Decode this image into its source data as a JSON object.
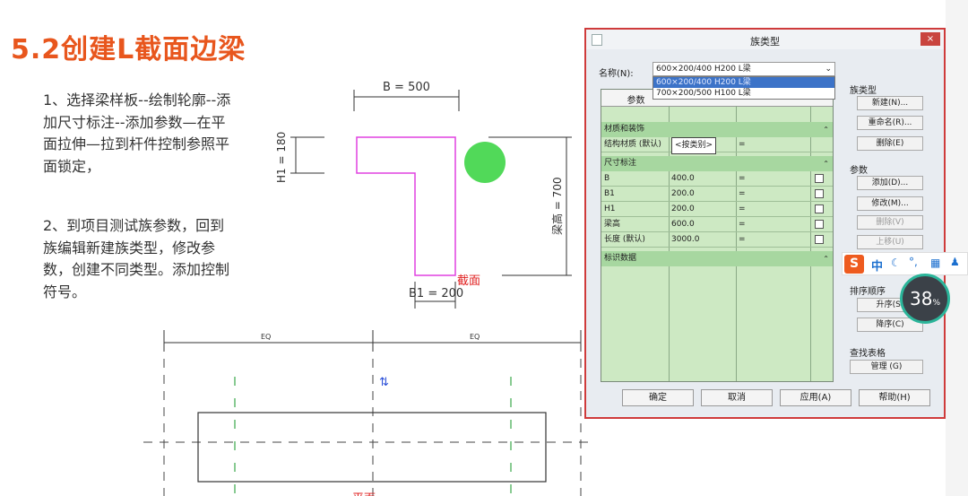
{
  "slide": {
    "title": "5.2创建L截面边梁",
    "para1": "1、选择梁样板--绘制轮廓--添加尺寸标注--添加参数—在平面拉伸—拉到杆件控制参照平面锁定，",
    "para2": "2、到项目测试族参数，回到族编辑新建族类型，修改参数，创建不同类型。添加控制符号。"
  },
  "drawing": {
    "dim_b": "B = 500",
    "dim_h1": "H1 = 180",
    "dim_h": "梁高 = 700",
    "dim_b1": "B1 = 200",
    "section_label": "截面",
    "eq_left": "EQ",
    "eq_right": "EQ",
    "plan_label": "平面",
    "colors": {
      "profile": "#e040e0",
      "label_red": "#e02020",
      "marker_green": "#32d23c"
    }
  },
  "dialog": {
    "title": "族类型",
    "close": "×",
    "name_label": "名称(N):",
    "name_value": "600×200/400 H200 L梁",
    "dropdown": [
      "600×200/400 H200 L梁",
      "700×200/500 H100 L梁"
    ],
    "col_param": "参数",
    "group_material": "材质和装饰",
    "material_row": {
      "name": "结构材质 (默认)",
      "value": "<按类别>",
      "formula": "="
    },
    "group_dims": "尺寸标注",
    "dim_rows": [
      {
        "name": "B",
        "value": "400.0",
        "formula": "="
      },
      {
        "name": "B1",
        "value": "200.0",
        "formula": "="
      },
      {
        "name": "H1",
        "value": "200.0",
        "formula": "="
      },
      {
        "name": "梁高",
        "value": "600.0",
        "formula": "="
      },
      {
        "name": "长度 (默认)",
        "value": "3000.0",
        "formula": "="
      }
    ],
    "group_id": "标识数据",
    "family_types_label": "族类型",
    "btn_new": "新建(N)...",
    "btn_rename": "重命名(R)...",
    "btn_delete": "删除(E)",
    "params_label": "参数",
    "btn_add": "添加(D)...",
    "btn_modify": "修改(M)...",
    "btn_remove": "删除(V)",
    "btn_up": "上移(U)",
    "sort_label": "排序顺序",
    "btn_asc": "升序(S)",
    "btn_desc": "降序(C)",
    "lookup_label": "查找表格",
    "btn_manage": "管理 (G)",
    "btn_ok": "确定",
    "btn_cancel": "取消",
    "btn_apply": "应用(A)",
    "btn_help": "帮助(H)"
  },
  "ime": {
    "logo": "S",
    "lang": "中"
  },
  "gauge": {
    "value": "38",
    "unit": "%"
  }
}
